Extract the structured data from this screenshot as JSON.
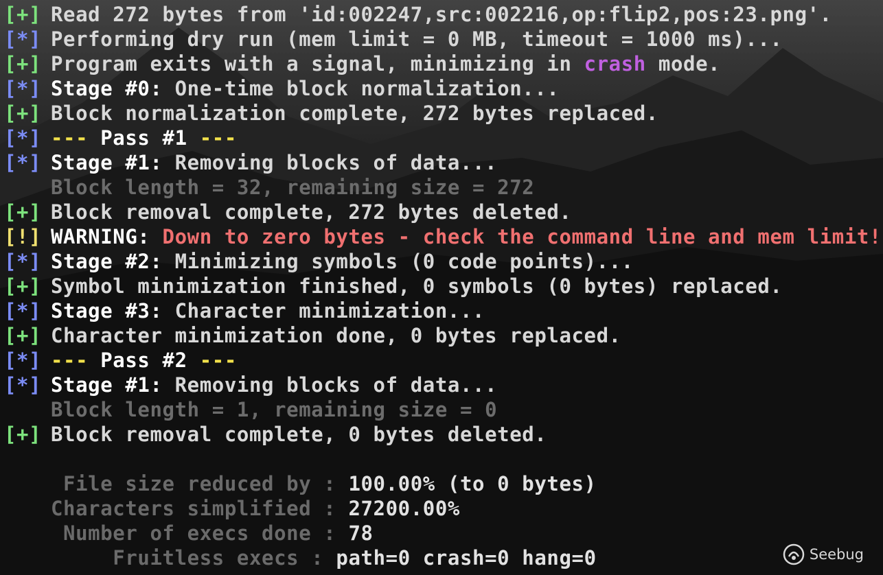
{
  "colors": {
    "plus_prefix": "#7de27d",
    "star_prefix": "#7b8cf5",
    "warn_prefix": "#f0e070",
    "highlight_yellow": "#f2e14b",
    "warning_red": "#f07070",
    "crash_magenta": "#c060e0",
    "dim_gray": "#6c6c6c"
  },
  "lines": [
    {
      "prefix": "[+]",
      "text": "Read 272 bytes from 'id:002247,src:002216,op:flip2,pos:23.png'."
    },
    {
      "prefix": "[*]",
      "text": "Performing dry run (mem limit = 0 MB, timeout = 1000 ms)..."
    },
    {
      "prefix": "[+]",
      "text_before": "Program exits with a signal, minimizing in ",
      "mode": "crash",
      "text_after": " mode."
    },
    {
      "prefix": "[*]",
      "stage": "Stage #0:",
      "text": " One-time block normalization..."
    },
    {
      "prefix": "[+]",
      "text": "Block normalization complete, 272 bytes replaced."
    },
    {
      "prefix": "[*]",
      "dashes_left": "---",
      "pass": " Pass #1 ",
      "dashes_right": "---"
    },
    {
      "prefix": "[*]",
      "stage": "Stage #1:",
      "text": " Removing blocks of data..."
    },
    {
      "text": "Block length = 32, remaining size = 272"
    },
    {
      "prefix": "[+]",
      "text": "Block removal complete, 272 bytes deleted."
    },
    {
      "prefix": "[!]",
      "label": "WARNING:",
      "text": " Down to zero bytes - check the command line and mem limit!"
    },
    {
      "prefix": "[*]",
      "stage": "Stage #2:",
      "text": " Minimizing symbols (0 code points)..."
    },
    {
      "prefix": "[+]",
      "text": "Symbol minimization finished, 0 symbols (0 bytes) replaced."
    },
    {
      "prefix": "[*]",
      "stage": "Stage #3:",
      "text": " Character minimization..."
    },
    {
      "prefix": "[+]",
      "text": "Character minimization done, 0 bytes replaced."
    },
    {
      "prefix": "[*]",
      "dashes_left": "---",
      "pass": " Pass #2 ",
      "dashes_right": "---"
    },
    {
      "prefix": "[*]",
      "stage": "Stage #1:",
      "text": " Removing blocks of data..."
    },
    {
      "text": "Block length = 1, remaining size = 0"
    },
    {
      "prefix": "[+]",
      "text": "Block removal complete, 0 bytes deleted."
    }
  ],
  "stats": [
    {
      "label": " File size reduced by",
      "value": "100.00% (to 0 bytes)"
    },
    {
      "label": "Characters simplified",
      "value": "27200.00%"
    },
    {
      "label": " Number of execs done",
      "value": "78"
    },
    {
      "label": "     Fruitless execs",
      "value": "path=0 crash=0 hang=0"
    }
  ],
  "watermark": {
    "brand": "Seebug",
    "icon": "seebug-logo-icon"
  }
}
